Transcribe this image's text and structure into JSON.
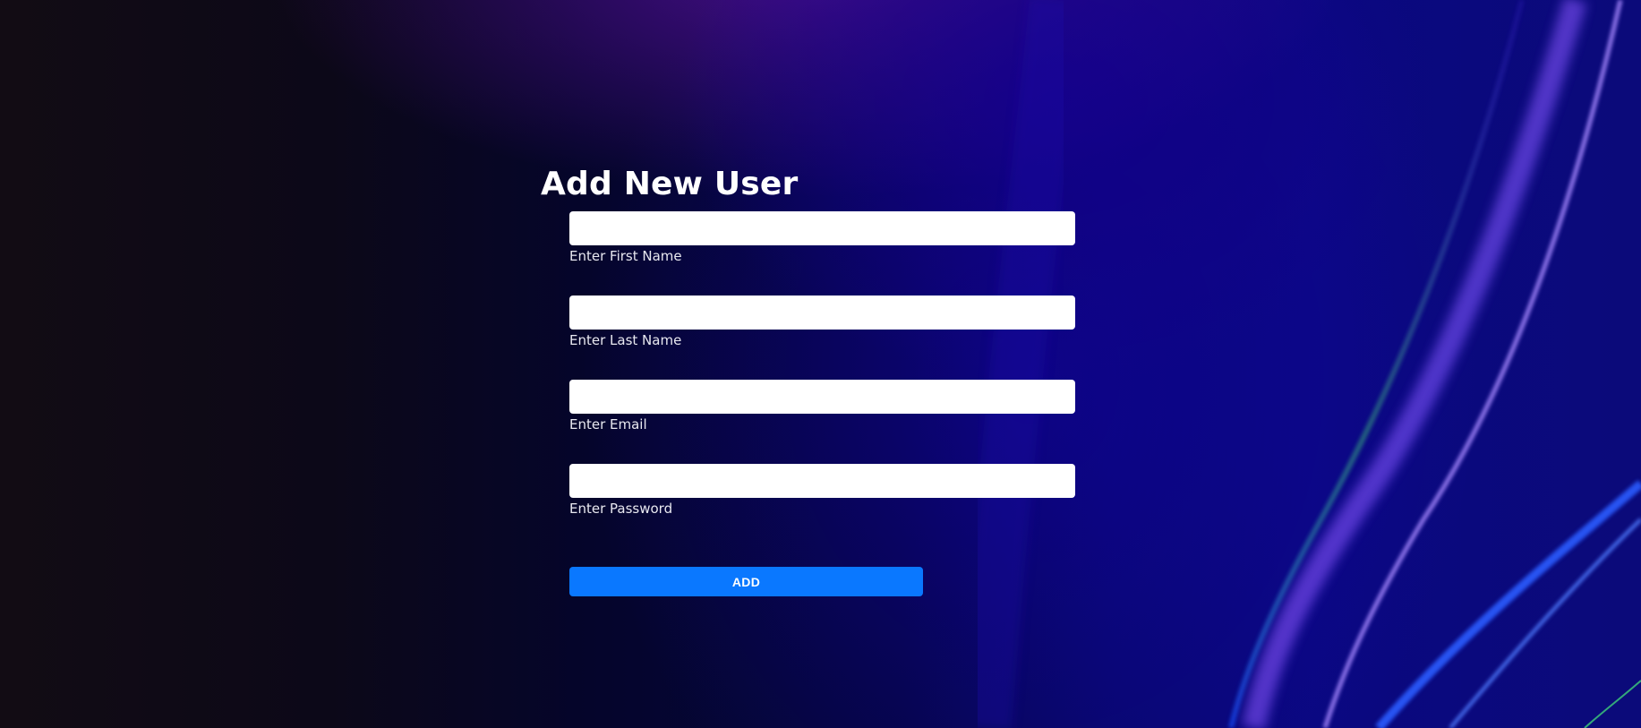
{
  "page": {
    "title": "Add New User"
  },
  "form": {
    "fields": [
      {
        "label": "Enter First Name",
        "value": "",
        "placeholder": ""
      },
      {
        "label": "Enter Last Name",
        "value": "",
        "placeholder": ""
      },
      {
        "label": "Enter Email",
        "value": "",
        "placeholder": ""
      },
      {
        "label": "Enter Password",
        "value": "",
        "placeholder": ""
      }
    ],
    "submit_label": "ADD"
  },
  "colors": {
    "button": "#0a78ff",
    "text": "#ffffff",
    "input_bg": "#ffffff",
    "background_dark": "#0c0818",
    "background_blue": "#0a0880"
  }
}
